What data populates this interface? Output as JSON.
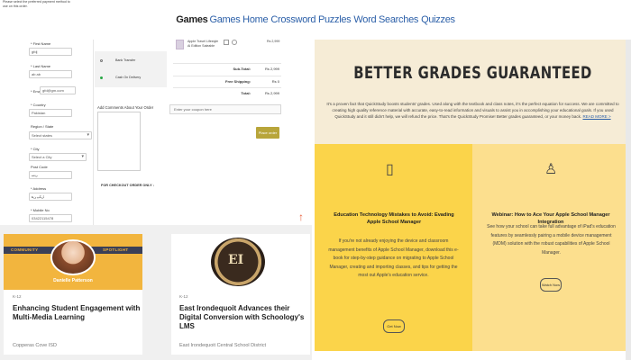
{
  "nav": {
    "brand": "Games",
    "links": [
      "Games Home",
      "Crossword Puzzles",
      "Word Searches",
      "Quizzes"
    ]
  },
  "form": {
    "first_name_label": "* First Name",
    "first_name_value": "gfdj",
    "last_name_label": "* Last Name",
    "last_name_value": "ab ab",
    "email_label": "* Email",
    "email_value": "gfd@gm.com",
    "country_label": "* Country",
    "country_value": "Pakistan",
    "region_label": "Region / State",
    "region_value": "Select states",
    "city_label": "* City",
    "city_value": "Select a City",
    "postcode_label": "Post Code",
    "postcode_value": "ﺮﺘﺳ",
    "address_label": "* Address",
    "address_value": "ﻞﮑﯿﭘ ﻦﻫ",
    "mobile_label": "* Mobile No",
    "mobile_value": "03422115478"
  },
  "payment": {
    "note": "Please select the preferred payment method to use on this order.",
    "option1": "Bank Transfer",
    "option2": "Cash On Delivery",
    "comments_label": "Add Comments About Your Order",
    "checkout_line": "FOR CHECKOUT ORDER ONLY ↓"
  },
  "summary": {
    "product_text": "Apple Travel Lifestyle Ai Edition Saleable",
    "product_price": "Rs 2,999",
    "sub_total_label": "Sub-Total:",
    "sub_total_value": "Rs 2,999",
    "shipping_label": "Free Shipping:",
    "shipping_value": "Rs 0",
    "total_label": "Total:",
    "total_value": "Rs 2,999",
    "coupon_placeholder": "Enter your coupon here",
    "coupon_button": "Place order",
    "scroll_top": "↑"
  },
  "cards": [
    {
      "tag": "K-12",
      "title": "Enhancing Student Engagement with Multi-Media Learning",
      "source": "Copperas Cove ISD",
      "community_label": "COMMUNITY",
      "spotlight_label": "SPOTLIGHT",
      "person_name": "Danielle Patterson"
    },
    {
      "tag": "K-12",
      "title": "East Irondequoit Advances their Digital Conversion with Schoology's LMS",
      "source": "East Irondequoit Central School District",
      "seal_letters": "EI"
    }
  ],
  "hero": {
    "title": "BETTER GRADES GUARANTEED",
    "text": "It's a proven fact that QuickStudy boosts students' grades. Used along with the textbook and class notes, it's the perfect equation for success. We are committed to creating high quality reference material with accurate, easy-to-read information and visuals to assist you in accomplishing your educational goals. If you used QuickStudy and it still didn't help, we will refund the price. That's the QuickStudy Promise! Better grades guaranteed, or your money back.",
    "link": "READ MORE >"
  },
  "panels": [
    {
      "icon": "phone-checklist-icon",
      "title": "Education Technology Mistakes to Avoid: Evading Apple School Manager",
      "body": "If you're not already enjoying the device and classroom management benefits of Apple School Manager, download this e-book for step-by-step guidance on migrating to Apple School Manager, creating and importing classes, and tips for getting the most out Apple's education service.",
      "button": "Get Now"
    },
    {
      "icon": "org-chart-icon",
      "title": "Webinar: How to Ace Your Apple School Manager Integration",
      "body": "See how your school can take full advantage of iPad's education features by seamlessly pairing a mobile device management (MDM) solution with the robust capabilities of Apple School Manager.",
      "button": "Watch Now"
    }
  ],
  "colors": {
    "accent": "#b8a53a",
    "panel_left": "#fbd44a",
    "panel_right": "#fcdf8e",
    "hero_bg": "#f6ecd6",
    "link": "#2b5fa8",
    "scroll_top": "#e8603c"
  }
}
